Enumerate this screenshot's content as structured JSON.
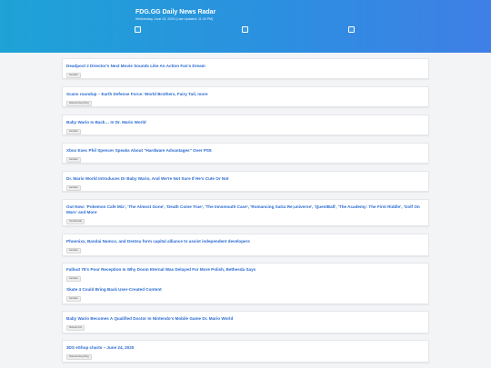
{
  "header": {
    "title": "FDG.GG Daily News Radar",
    "subtitle": "Wednesday, June 24, 2020 (Last Updated: 11:44 PM)"
  },
  "articles": [
    {
      "title": "Deadpool 2 Director's Next Movie Sounds Like An Action Fan's Dream",
      "tag": "Gematsu"
    },
    {
      "title": "Scans roundup – Earth Defense Force: World Brothers, Fairy Tail, more",
      "tag": "Nintendo Everything"
    },
    {
      "title": "Baby Wario Is Back… In Dr. Mario World",
      "tag": "Gematsu"
    },
    {
      "title": "Xbox Exec Phil Spencer Speaks About \"Hardware Advantages\" Over PS5",
      "tag": "Gematsu"
    },
    {
      "title": "Dr. Mario World Introduces Dr Baby Wario, And We're Not Sure If He's Cute Or Not",
      "tag": "Gematsu"
    },
    {
      "title": "Out Now: 'Pokemon Cafe Mix', 'The Almost Gone', 'Death Come True', 'The Innsmouth Case', 'Romancing SaGa Re;universe', 'QuestBall', 'The Academy: The First Riddle', 'Golf On Mars' and More",
      "tag": "TouchArcade"
    },
    {
      "title": "Phoenixx, Bandai Namco, and Dentsu form capital alliance to assist independent developers",
      "tag": "Gematsu"
    },
    {
      "title": "Fallout 76's Poor Reception Is Why Doom Eternal Was Delayed For More Polish, Bethesda Says",
      "tag": "Gematsu"
    },
    {
      "title": "Skate 4 Could Bring Back User-Created Content",
      "tag": "Gematsu"
    },
    {
      "title": "Baby Wario Becomes A Qualified Doctor In Nintendo's Mobile Game Dr. Mario World",
      "tag": "Nintendo Life"
    },
    {
      "title": "3DS eShop charts – June 24, 2020",
      "tag": "Nintendo Everything"
    }
  ]
}
